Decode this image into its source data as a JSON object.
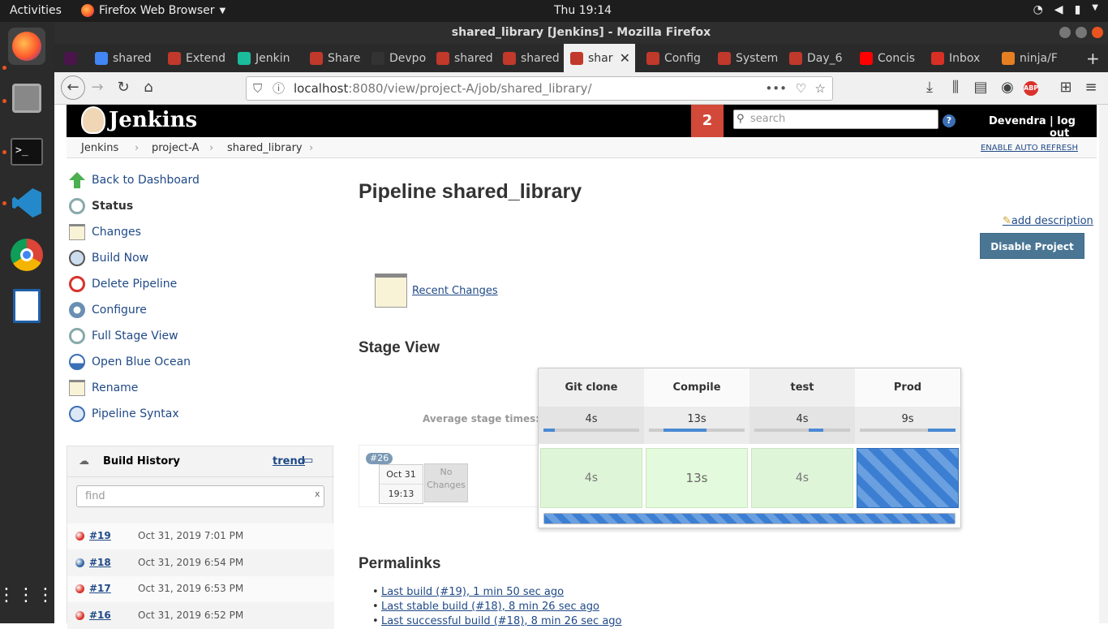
{
  "topbar": {
    "activities": "Activities",
    "app_name": "Firefox Web Browser",
    "clock": "Thu 19:14"
  },
  "window": {
    "title": "shared_library [Jenkins] - Mozilla Firefox"
  },
  "tabs": [
    {
      "label": "",
      "color": "#4a154b"
    },
    {
      "label": "shared",
      "color": "#4285f4"
    },
    {
      "label": "Extend",
      "color": "#c0392b"
    },
    {
      "label": "Jenkin",
      "color": "#1abc9c"
    },
    {
      "label": "Share",
      "color": "#c0392b"
    },
    {
      "label": "Devpo",
      "color": "#333333"
    },
    {
      "label": "shared",
      "color": "#c0392b"
    },
    {
      "label": "shared",
      "color": "#c0392b"
    },
    {
      "label": "shar",
      "color": "#c0392b",
      "active": true
    },
    {
      "label": "Config",
      "color": "#c0392b"
    },
    {
      "label": "System",
      "color": "#c0392b"
    },
    {
      "label": "Day_6",
      "color": "#c0392b"
    },
    {
      "label": "Concis",
      "color": "#ff0000"
    },
    {
      "label": "Inbox",
      "color": "#d93025"
    },
    {
      "label": "ninja/F",
      "color": "#e67e22"
    }
  ],
  "url": {
    "host": "localhost",
    "rest": ":8080/view/project-A/job/shared_library/"
  },
  "jenkins": {
    "logo": "Jenkins",
    "notif_count": "2",
    "search_placeholder": "search",
    "user": "Devendra",
    "logout": "| log out",
    "auto_refresh": "ENABLE AUTO REFRESH"
  },
  "breadcrumb": [
    "Jenkins",
    "project-A",
    "shared_library"
  ],
  "sidebar": [
    {
      "label": "Back to Dashboard",
      "icon": "up-arrow-icon"
    },
    {
      "label": "Status",
      "icon": "magnifier-icon",
      "bold": true
    },
    {
      "label": "Changes",
      "icon": "notepad-icon"
    },
    {
      "label": "Build Now",
      "icon": "clock-icon"
    },
    {
      "label": "Delete Pipeline",
      "icon": "no-entry-icon"
    },
    {
      "label": "Configure",
      "icon": "gear-icon"
    },
    {
      "label": "Full Stage View",
      "icon": "magnifier-icon"
    },
    {
      "label": "Open Blue Ocean",
      "icon": "blue-ocean-icon"
    },
    {
      "label": "Rename",
      "icon": "notepad-icon"
    },
    {
      "label": "Pipeline Syntax",
      "icon": "help-icon"
    }
  ],
  "build_history": {
    "title": "Build History",
    "trend": "trend",
    "find_placeholder": "find",
    "clear": "x",
    "builds": [
      {
        "num": "#19",
        "date": "Oct 31, 2019 7:01 PM",
        "status": "failed",
        "color": "#d9322b"
      },
      {
        "num": "#18",
        "date": "Oct 31, 2019 6:54 PM",
        "status": "success",
        "color": "#3465a4"
      },
      {
        "num": "#17",
        "date": "Oct 31, 2019 6:53 PM",
        "status": "failed",
        "color": "#d9322b"
      },
      {
        "num": "#16",
        "date": "Oct 31, 2019 6:52 PM",
        "status": "failed",
        "color": "#d9322b"
      }
    ]
  },
  "main": {
    "title": "Pipeline shared_library",
    "add_description": "add description",
    "disable_button": "Disable Project",
    "recent_changes": "Recent Changes"
  },
  "stage_view": {
    "heading": "Stage View",
    "avg_label": "Average stage times:",
    "stages": [
      {
        "name": "Git clone",
        "avg": "4s",
        "cell": "4s",
        "bar_start": 0.0,
        "bar_fill": 0.12
      },
      {
        "name": "Compile",
        "avg": "13s",
        "cell": "13s",
        "bar_start": 0.15,
        "bar_fill": 0.45
      },
      {
        "name": "test",
        "avg": "4s",
        "cell": "4s",
        "bar_start": 0.57,
        "bar_fill": 0.15
      },
      {
        "name": "Prod",
        "avg": "9s",
        "cell": "",
        "bar_start": 0.71,
        "bar_fill": 0.29,
        "running": true
      }
    ],
    "run": {
      "badge": "#26",
      "date": "Oct 31",
      "time": "19:13",
      "changes": "No Changes"
    }
  },
  "permalinks": {
    "heading": "Permalinks",
    "links": [
      "Last build (#19), 1 min 50 sec ago",
      "Last stable build (#18), 8 min 26 sec ago",
      "Last successful build (#18), 8 min 26 sec ago"
    ]
  }
}
